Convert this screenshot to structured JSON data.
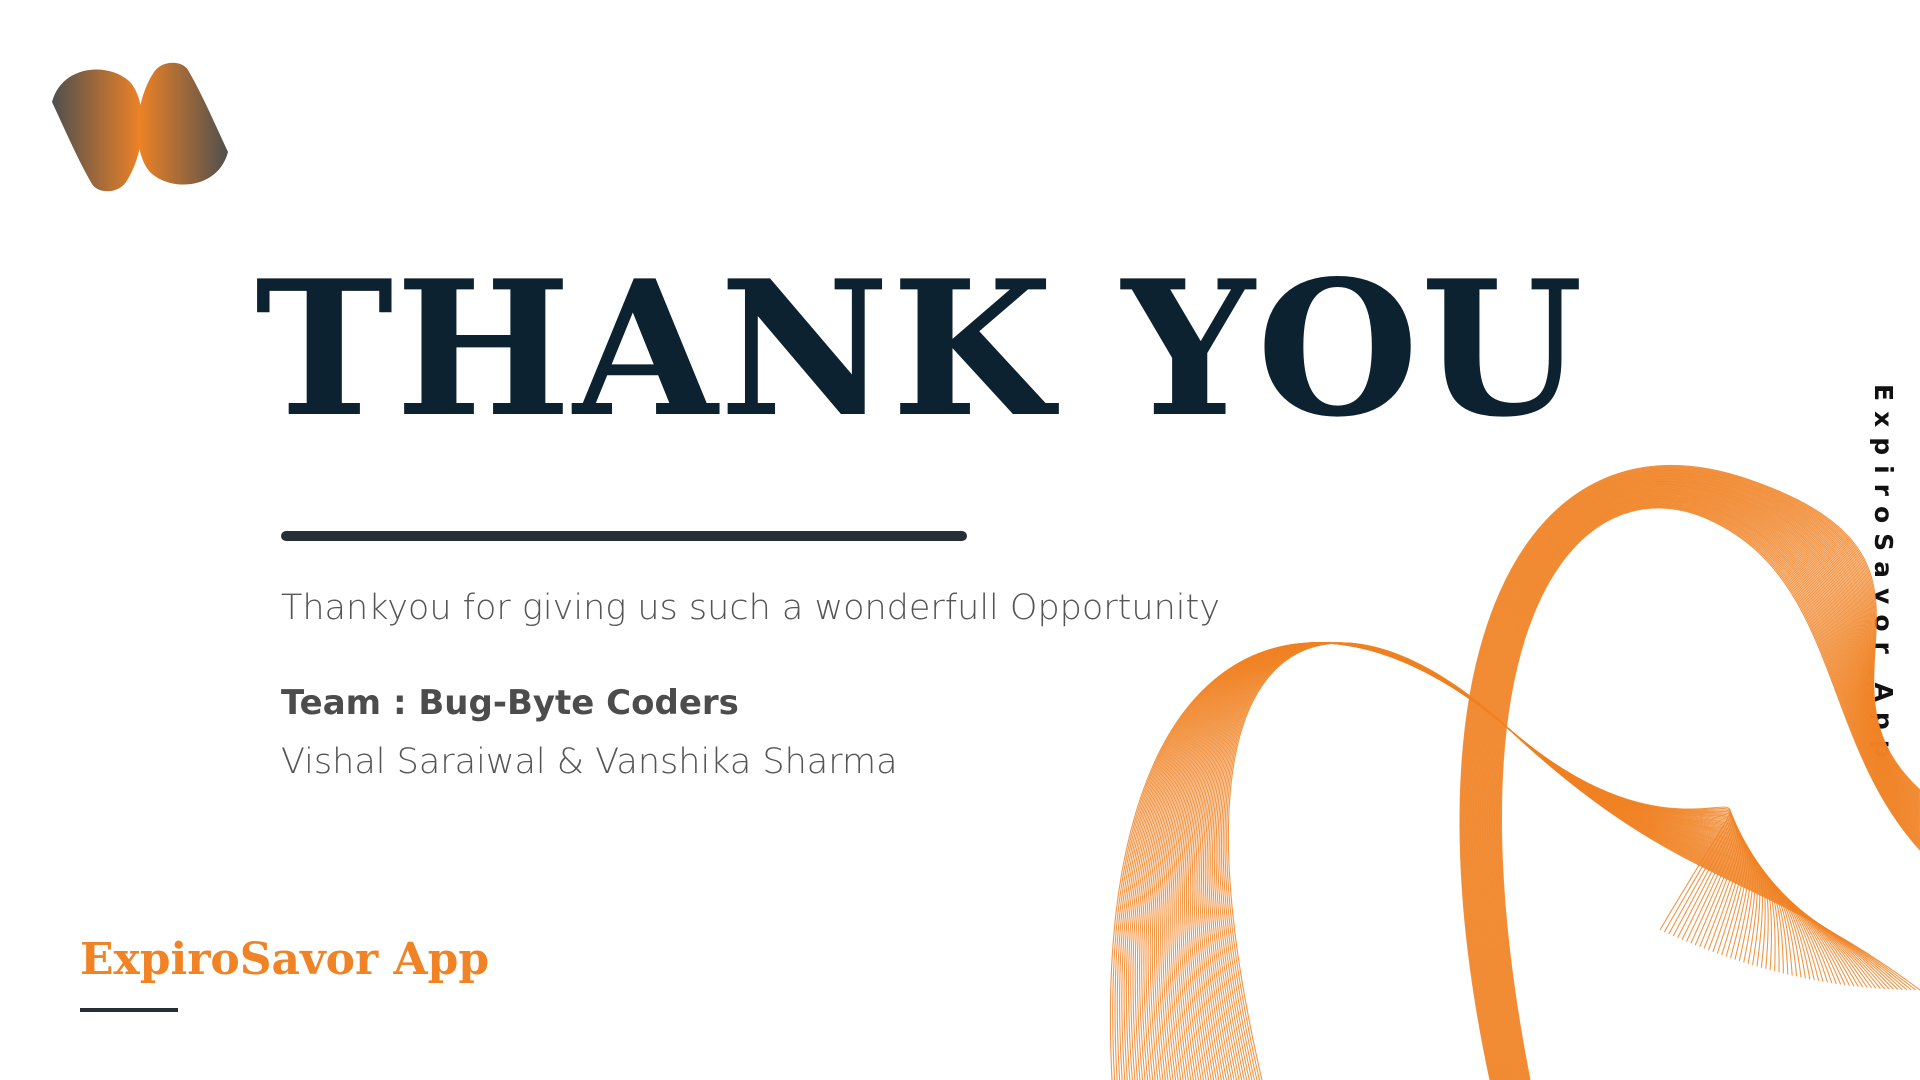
{
  "slide": {
    "title": "THANK YOU",
    "subtitle": "Thankyou for giving us such a wonderfull Opportunity",
    "team_label": "Team : Bug-Byte Coders",
    "members": "Vishal Saraiwal & Vanshika Sharma",
    "brand": "ExpiroSavor App",
    "side_label": "ExpiroSavor App"
  },
  "colors": {
    "accent": "#f08325",
    "title": "#0d2230",
    "logo_dark": "#4f4f4f",
    "logo_light": "#f08325"
  },
  "icons": {
    "logo": "company-logo-icon",
    "decoration": "orange-wave-lines"
  }
}
